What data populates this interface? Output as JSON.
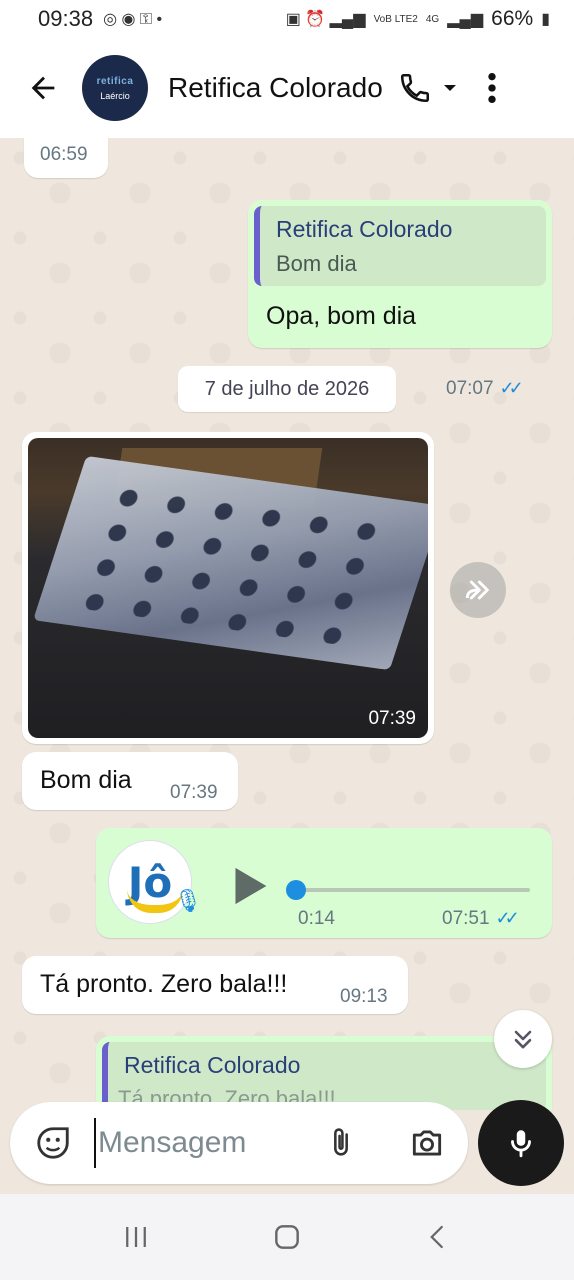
{
  "status_bar": {
    "time": "09:38",
    "battery": "66%",
    "network_label": "4G",
    "volte_label": "VoB LTE2"
  },
  "header": {
    "contact_name": "Retifica Colorado",
    "avatar_top_text": "retifica",
    "avatar_bottom_text": "Laércio"
  },
  "messages": {
    "top_partial_time": "06:59",
    "reply": {
      "quote_name": "Retifica Colorado",
      "quote_text": "Bom dia",
      "text": "Opa, bom dia",
      "time": "07:07"
    },
    "date_separator": "7 de julho de 2026",
    "image_time": "07:39",
    "bom_dia": {
      "text": "Bom dia",
      "time": "07:39"
    },
    "voice": {
      "duration": "0:14",
      "time": "07:51",
      "progress": 0.0,
      "avatar_text": "Jô"
    },
    "pronto": {
      "text": "Tá pronto. Zero bala!!!",
      "time": "09:13"
    },
    "partial": {
      "quote_name": "Retifica Colorado",
      "quote_text_partial": "Tá pronto. Zero bala!!!"
    }
  },
  "input": {
    "placeholder": "Mensagem"
  },
  "colors": {
    "outgoing_bubble": "#d9fdd3",
    "incoming_bubble": "#ffffff",
    "quote_bar": "#6b5fce",
    "read_ticks": "#1f8cdc",
    "chat_background": "#efe7dd"
  },
  "icons": [
    "back-arrow-icon",
    "phone-icon",
    "chevron-down-icon",
    "more-vertical-icon",
    "forward-icon",
    "play-icon",
    "mic-icon",
    "chevrons-down-icon",
    "sticker-icon",
    "attach-icon",
    "camera-icon",
    "recent-apps-icon",
    "home-icon",
    "nav-back-icon"
  ]
}
